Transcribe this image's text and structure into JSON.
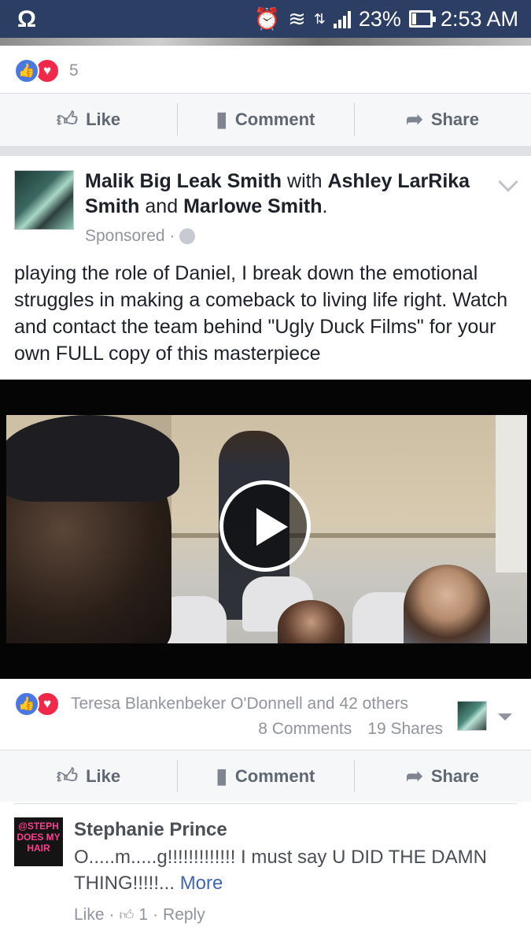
{
  "status_bar": {
    "left_glyph": "Ω",
    "alarm_glyph": "⏰",
    "wifi_glyph": "≋",
    "data_glyph": "⇅",
    "battery_percent": "23%",
    "battery_level": 0.23,
    "time": "2:53 AM"
  },
  "previous_post": {
    "reaction_count": "5",
    "actions": {
      "like": "Like",
      "comment": "Comment",
      "share": "Share"
    }
  },
  "post": {
    "author": "Malik Big Leak Smith",
    "with_word": "with",
    "tagged_1": "Ashley LarRika Smith",
    "and_word": "and",
    "tagged_2": "Marlowe Smith",
    "period": ".",
    "sponsored": "Sponsored ·",
    "text": "playing the role of Daniel, I break down the emotional struggles in making a comeback to living life right. Watch and contact the team behind \"Ugly Duck Films\" for your own FULL copy of this masterpiece",
    "reactions_names": "Teresa Blankenbeker O'Donnell and 42 others",
    "comments_count": "8 Comments",
    "shares_count": "19 Shares",
    "actions": {
      "like": "Like",
      "comment": "Comment",
      "share": "Share"
    }
  },
  "comment": {
    "avatar_text": "@STEPH DOES MY HAIR",
    "author": "Stephanie Prince",
    "text": "O.....m.....g!!!!!!!!!!!!! I must say U DID THE DAMN THING!!!!!...",
    "more": "More",
    "like": "Like",
    "sep1": "·",
    "likes_count": "1",
    "sep2": "·",
    "reply": "Reply"
  },
  "icons": {
    "like_reaction": "like-reaction-icon",
    "love_reaction": "love-reaction-icon",
    "thumbs_up": "thumbs-up-icon",
    "comment": "comment-bubble-icon",
    "share": "share-arrow-icon",
    "globe": "globe-icon",
    "play": "play-icon"
  },
  "colors": {
    "status_bar": "#2c3e63",
    "like_blue": "#4a78e3",
    "love_red": "#f0284a",
    "link": "#4267b2",
    "muted": "#90949c"
  }
}
